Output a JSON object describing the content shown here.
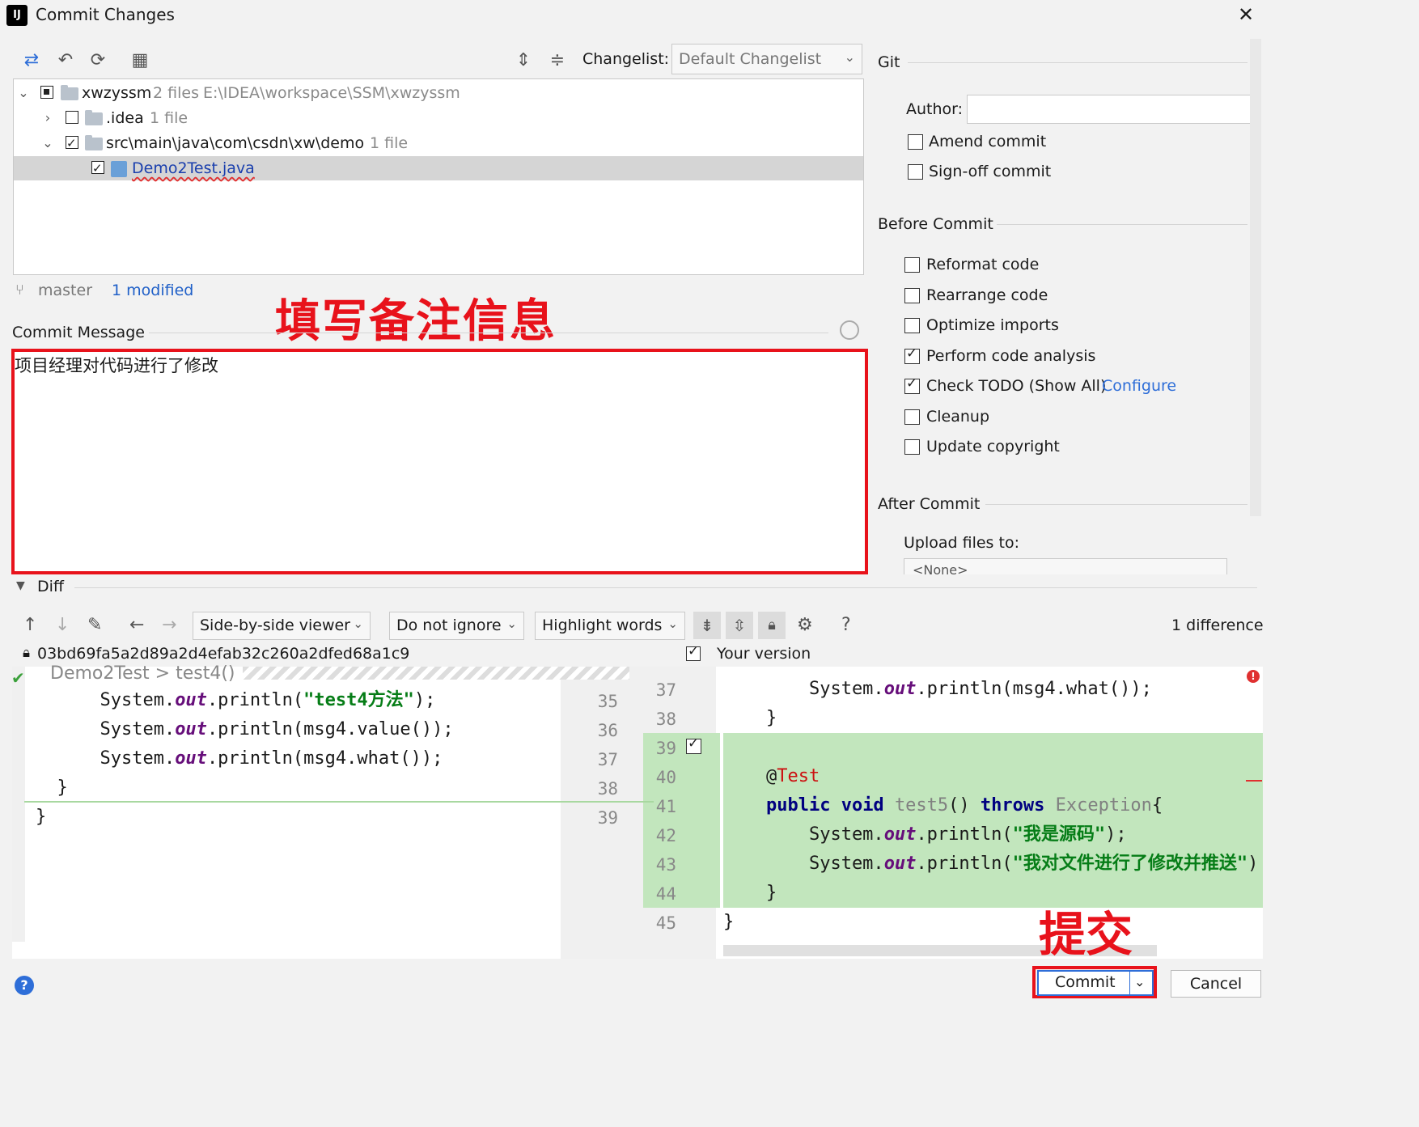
{
  "window": {
    "title": "Commit Changes",
    "close_glyph": "✕",
    "app_icon": "intellij-idea-icon"
  },
  "toolbar": {
    "changelist_label": "Changelist:",
    "changelist_value": "Default Changelist"
  },
  "tree": {
    "root": {
      "name": "xwzyssm",
      "count": "2 files",
      "path": "E:\\IDEA\\workspace\\SSM\\xwzyssm"
    },
    "idea": {
      "name": ".idea",
      "count": "1 file"
    },
    "src": {
      "name": "src\\main\\java\\com\\csdn\\xw\\demo",
      "count": "1 file"
    },
    "file": {
      "name": "Demo2Test.java"
    }
  },
  "status": {
    "branch": "master",
    "modified": "1 modified"
  },
  "annotations": {
    "fill_note": "填写备注信息",
    "submit": "提交"
  },
  "commit_message": {
    "label": "Commit Message",
    "text": "项目经理对代码进行了修改"
  },
  "git_panel": {
    "section": "Git",
    "author_label": "Author:",
    "author_value": "",
    "amend": "Amend commit",
    "signoff": "Sign-off commit"
  },
  "before_commit": {
    "section": "Before Commit",
    "options": [
      {
        "label": "Reformat code",
        "checked": false
      },
      {
        "label": "Rearrange code",
        "checked": false
      },
      {
        "label": "Optimize imports",
        "checked": false
      },
      {
        "label": "Perform code analysis",
        "checked": true
      },
      {
        "label": "Check TODO (Show All)",
        "checked": true,
        "link": "Configure"
      },
      {
        "label": "Cleanup",
        "checked": false
      },
      {
        "label": "Update copyright",
        "checked": false
      }
    ]
  },
  "after_commit": {
    "section": "After Commit",
    "upload_label": "Upload files to:",
    "upload_value": "<None>"
  },
  "diff": {
    "title": "Diff",
    "viewer": "Side-by-side viewer",
    "ignore": "Do not ignore",
    "highlight": "Highlight words",
    "help": "?",
    "differences": "1 difference",
    "hash": "03bd69fa5a2d89a2d4efab32c260a2dfed68a1c9",
    "your_version": "Your version",
    "breadcrumb": "Demo2Test > test4()",
    "left_line_numbers": [
      "35",
      "36",
      "37",
      "38",
      "39"
    ],
    "right_line_numbers": [
      "37",
      "38",
      "39",
      "40",
      "41",
      "42",
      "43",
      "44",
      "45"
    ]
  },
  "buttons": {
    "commit": "Commit",
    "cancel": "Cancel",
    "help": "?"
  }
}
